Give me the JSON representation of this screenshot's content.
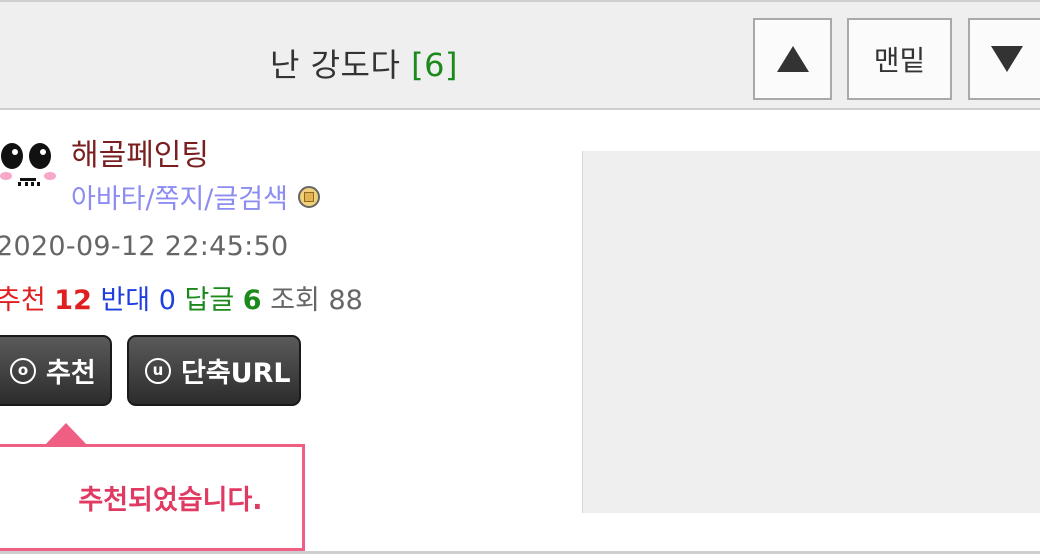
{
  "header": {
    "title": "난 강도다",
    "comment_count": "[6]",
    "btn_bottom_label": "맨밑",
    "btn_up_icon": "triangle-up-icon",
    "btn_down_icon": "triangle-down-icon"
  },
  "post": {
    "author": "해골페인팅",
    "author_links": "아바타/쪽지/글검색",
    "badge_icon": "level-badge-icon",
    "avatar_icon": "skull-avatar-icon",
    "date": "2020-09-12 22:45:50",
    "stats": {
      "recommend_label": "추천",
      "recommend_value": "12",
      "oppose_label": "반대",
      "oppose_value": "0",
      "reply_label": "답글",
      "reply_value": "6",
      "views_label": "조회",
      "views_value": "88"
    }
  },
  "actions": {
    "recommend_icon_glyph": "o",
    "recommend_label": "추천",
    "shorturl_icon_glyph": "u",
    "shorturl_label": "단축URL"
  },
  "popup": {
    "message": "추천되었습니다."
  },
  "colors": {
    "comment_count": "#1b8a1b",
    "author": "#7a1f1f",
    "links": "#8c8cf2",
    "recommend": "#e02020",
    "oppose": "#1e3ee0",
    "reply": "#1b8a1b",
    "popup_border": "#ee5f83",
    "popup_text": "#e03a62"
  }
}
